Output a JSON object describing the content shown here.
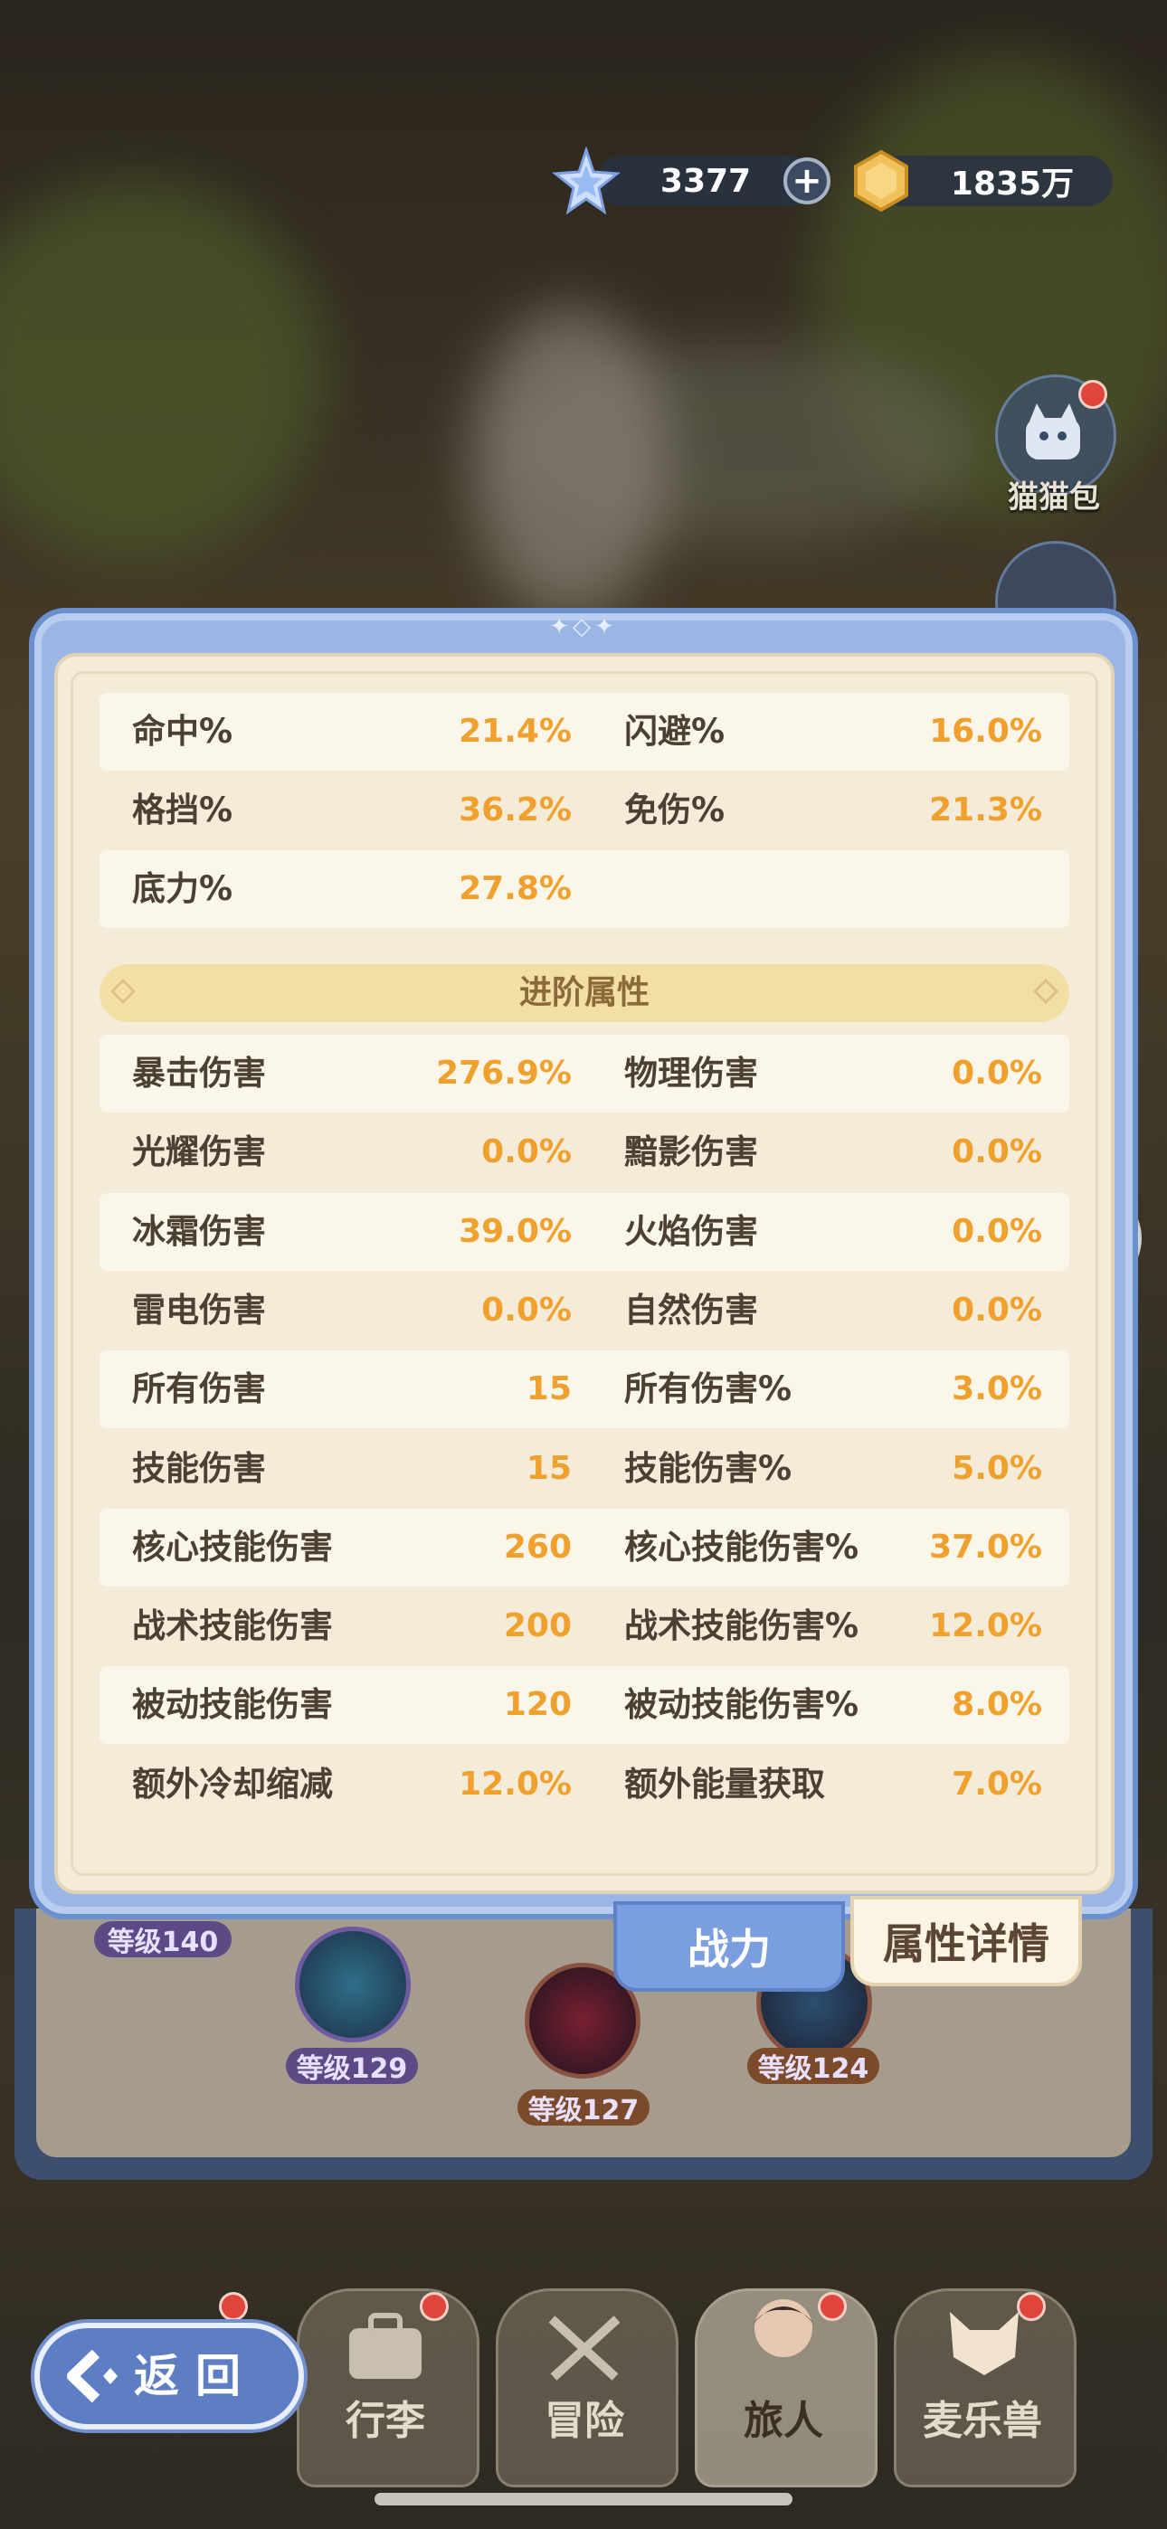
{
  "header": {
    "gems": "3377",
    "gold": "1835万"
  },
  "side": {
    "cat_bag_label": "猫猫包"
  },
  "basic_stats": [
    {
      "left_label": "命中%",
      "left_value": "21.4%",
      "right_label": "闪避%",
      "right_value": "16.0%"
    },
    {
      "left_label": "格挡%",
      "left_value": "36.2%",
      "right_label": "免伤%",
      "right_value": "21.3%"
    },
    {
      "left_label": "底力%",
      "left_value": "27.8%",
      "right_label": "",
      "right_value": ""
    }
  ],
  "advanced_title": "进阶属性",
  "advanced_stats": [
    {
      "left_label": "暴击伤害",
      "left_value": "276.9%",
      "right_label": "物理伤害",
      "right_value": "0.0%"
    },
    {
      "left_label": "光耀伤害",
      "left_value": "0.0%",
      "right_label": "黯影伤害",
      "right_value": "0.0%"
    },
    {
      "left_label": "冰霜伤害",
      "left_value": "39.0%",
      "right_label": "火焰伤害",
      "right_value": "0.0%"
    },
    {
      "left_label": "雷电伤害",
      "left_value": "0.0%",
      "right_label": "自然伤害",
      "right_value": "0.0%"
    },
    {
      "left_label": "所有伤害",
      "left_value": "15",
      "right_label": "所有伤害%",
      "right_value": "3.0%"
    },
    {
      "left_label": "技能伤害",
      "left_value": "15",
      "right_label": "技能伤害%",
      "right_value": "5.0%"
    },
    {
      "left_label": "核心技能伤害",
      "left_value": "260",
      "right_label": "核心技能伤害%",
      "right_value": "37.0%"
    },
    {
      "left_label": "战术技能伤害",
      "left_value": "200",
      "right_label": "战术技能伤害%",
      "right_value": "12.0%"
    },
    {
      "left_label": "被动技能伤害",
      "left_value": "120",
      "right_label": "被动技能伤害%",
      "right_value": "8.0%"
    },
    {
      "left_label": "额外冷却缩减",
      "left_value": "12.0%",
      "right_label": "额外能量获取",
      "right_value": "7.0%"
    }
  ],
  "tabs": {
    "power": "战力",
    "details": "属性详情"
  },
  "levels": {
    "l140": "等级140",
    "l129": "等级129",
    "l127": "等级127",
    "l124": "等级124"
  },
  "nav": {
    "back": "返回",
    "luggage": "行李",
    "adventure": "冒险",
    "traveler": "旅人",
    "beast": "麦乐兽"
  },
  "colors": {
    "value_orange": "#f0a02c",
    "label_brown": "#4b4032",
    "panel_blue": "#9bb6e5",
    "panel_cream": "#f4ecd9"
  }
}
